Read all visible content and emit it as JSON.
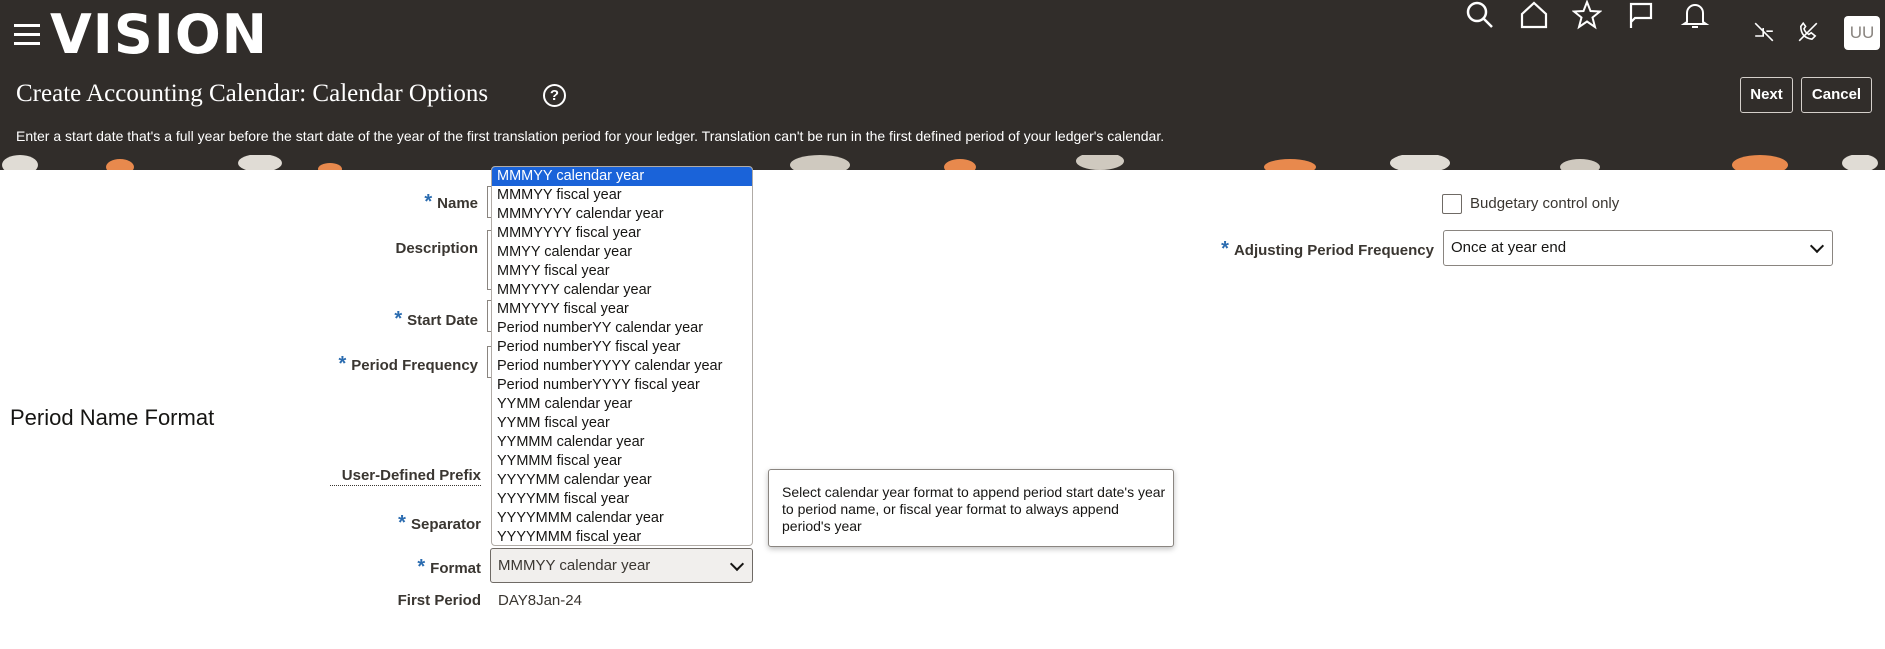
{
  "app": {
    "logo": "VISION",
    "avatar": "UU"
  },
  "header": {
    "title": "Create Accounting Calendar: Calendar Options",
    "next_label": "Next",
    "cancel_label": "Cancel",
    "instruction": "Enter a start date that's a full year before the start date of the year of the first translation period for your ledger. Translation can't be run in the first defined period of your ledger's calendar."
  },
  "form": {
    "name_label": "Name",
    "description_label": "Description",
    "start_date_label": "Start Date",
    "period_frequency_label": "Period Frequency",
    "budgetary_label": "Budgetary control only",
    "adjusting_label": "Adjusting Period Frequency",
    "adjusting_value": "Once at year end"
  },
  "period_name_format": {
    "heading": "Period Name Format",
    "prefix_label": "User-Defined Prefix",
    "separator_label": "Separator",
    "format_label": "Format",
    "format_value": "MMMYY calendar year",
    "first_period_label": "First Period",
    "first_period_value": "DAY8Jan-24"
  },
  "dropdown": {
    "options": [
      "MMMYY calendar year",
      "MMMYY fiscal year",
      "MMMYYYY calendar year",
      "MMMYYYY fiscal year",
      "MMYY calendar year",
      "MMYY fiscal year",
      "MMYYYY calendar year",
      "MMYYYY fiscal year",
      "Period numberYY calendar year",
      "Period numberYY fiscal year",
      "Period numberYYYY calendar year",
      "Period numberYYYY fiscal year",
      "YYMM calendar year",
      "YYMM fiscal year",
      "YYMMM calendar year",
      "YYMMM fiscal year",
      "YYYYMM calendar year",
      "YYYYMM fiscal year",
      "YYYYMMM calendar year",
      "YYYYMMM fiscal year"
    ],
    "selected_index": 0
  },
  "tooltip": {
    "text": "Select calendar year format to append period start date's year to period name, or fiscal year format to always append period's year"
  },
  "icons": [
    "search-icon",
    "home-icon",
    "star-icon",
    "flag-icon",
    "bell-icon",
    "no-signal-icon",
    "phone-off-icon"
  ]
}
